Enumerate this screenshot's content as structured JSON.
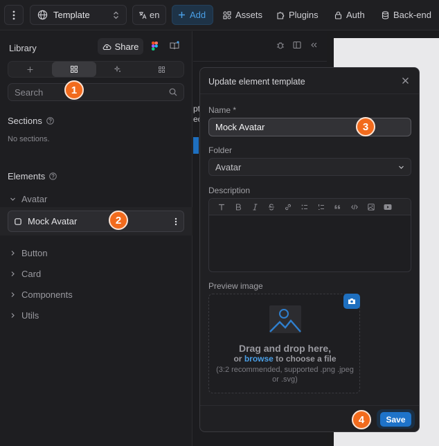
{
  "topbar": {
    "template_label": "Template",
    "lang_label": "en",
    "add_label": "Add",
    "assets_label": "Assets",
    "plugins_label": "Plugins",
    "auth_label": "Auth",
    "backend_label": "Back-end"
  },
  "library": {
    "title": "Library",
    "share_label": "Share",
    "search_placeholder": "Search",
    "sections_title": "Sections",
    "no_sections": "No sections.",
    "elements_title": "Elements",
    "groups": [
      "Avatar",
      "Button",
      "Card",
      "Components",
      "Utils"
    ],
    "selected_element": "Mock Avatar"
  },
  "middle": {
    "line1": "pt",
    "line2": "ec"
  },
  "modal": {
    "title": "Update element template",
    "name_label": "Name",
    "name_required": "*",
    "name_value": "Mock Avatar",
    "folder_label": "Folder",
    "folder_value": "Avatar",
    "description_label": "Description",
    "preview_label": "Preview image",
    "dz_main": "Drag and drop here,",
    "dz_or": "or",
    "dz_browse": "browse",
    "dz_rest": "to choose a file",
    "dz_hint_1": "(3:2 recommended, supported .png .jpeg",
    "dz_hint_2": "or .svg)",
    "save_label": "Save"
  },
  "badges": [
    "1",
    "2",
    "3",
    "4"
  ],
  "colors": {
    "accent": "#1e73c9",
    "badge": "#f26b1d"
  }
}
